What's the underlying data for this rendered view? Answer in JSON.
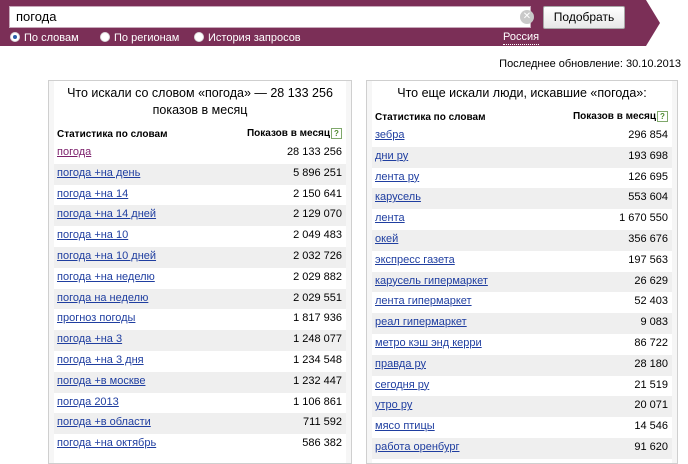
{
  "search": {
    "query": "погода",
    "submit_label": "Подобрать",
    "region_label": "Россия",
    "modes": [
      {
        "label": "По словам",
        "selected": true
      },
      {
        "label": "По регионам",
        "selected": false
      },
      {
        "label": "История запросов",
        "selected": false
      }
    ]
  },
  "last_update": "Последнее обновление: 30.10.2013",
  "left_table": {
    "title_line1": "Что искали со словом «погода» — 28 133 256",
    "title_line2": "показов в месяц",
    "col_phrase": "Статистика по словам",
    "col_count": "Показов в месяц",
    "rows": [
      {
        "phrase": "погода",
        "count": "28 133 256"
      },
      {
        "phrase": "погода +на день",
        "count": "5 896 251"
      },
      {
        "phrase": "погода +на 14",
        "count": "2 150 641"
      },
      {
        "phrase": "погода +на 14 дней",
        "count": "2 129 070"
      },
      {
        "phrase": "погода +на 10",
        "count": "2 049 483"
      },
      {
        "phrase": "погода +на 10 дней",
        "count": "2 032 726"
      },
      {
        "phrase": "погода +на неделю",
        "count": "2 029 882"
      },
      {
        "phrase": "погода на неделю",
        "count": "2 029 551"
      },
      {
        "phrase": "прогноз погоды",
        "count": "1 817 936"
      },
      {
        "phrase": "погода +на 3",
        "count": "1 248 077"
      },
      {
        "phrase": "погода +на 3 дня",
        "count": "1 234 548"
      },
      {
        "phrase": "погода +в москве",
        "count": "1 232 447"
      },
      {
        "phrase": "погода 2013",
        "count": "1 106 861"
      },
      {
        "phrase": "погода +в области",
        "count": "711 592"
      },
      {
        "phrase": "погода +на октябрь",
        "count": "586 382"
      }
    ]
  },
  "right_table": {
    "title": "Что еще искали люди, искавшие «погода»:",
    "col_phrase": "Статистика по словам",
    "col_count": "Показов в месяц",
    "rows": [
      {
        "phrase": "зебра",
        "count": "296 854"
      },
      {
        "phrase": "дни ру",
        "count": "193 698"
      },
      {
        "phrase": "лента ру",
        "count": "126 695"
      },
      {
        "phrase": "карусель",
        "count": "553 604"
      },
      {
        "phrase": "лента",
        "count": "1 670 550"
      },
      {
        "phrase": "окей",
        "count": "356 676"
      },
      {
        "phrase": "экспресс газета",
        "count": "197 563"
      },
      {
        "phrase": "карусель гипермаркет",
        "count": "26 629"
      },
      {
        "phrase": "лента гипермаркет",
        "count": "52 403"
      },
      {
        "phrase": "реал гипермаркет",
        "count": "9 083"
      },
      {
        "phrase": "метро кэш энд керри",
        "count": "86 722"
      },
      {
        "phrase": "правда ру",
        "count": "28 180"
      },
      {
        "phrase": "сегодня ру",
        "count": "21 519"
      },
      {
        "phrase": "утро ру",
        "count": "20 071"
      },
      {
        "phrase": "мясо птицы",
        "count": "14 546"
      },
      {
        "phrase": "работа оренбург",
        "count": "91 620"
      }
    ]
  }
}
